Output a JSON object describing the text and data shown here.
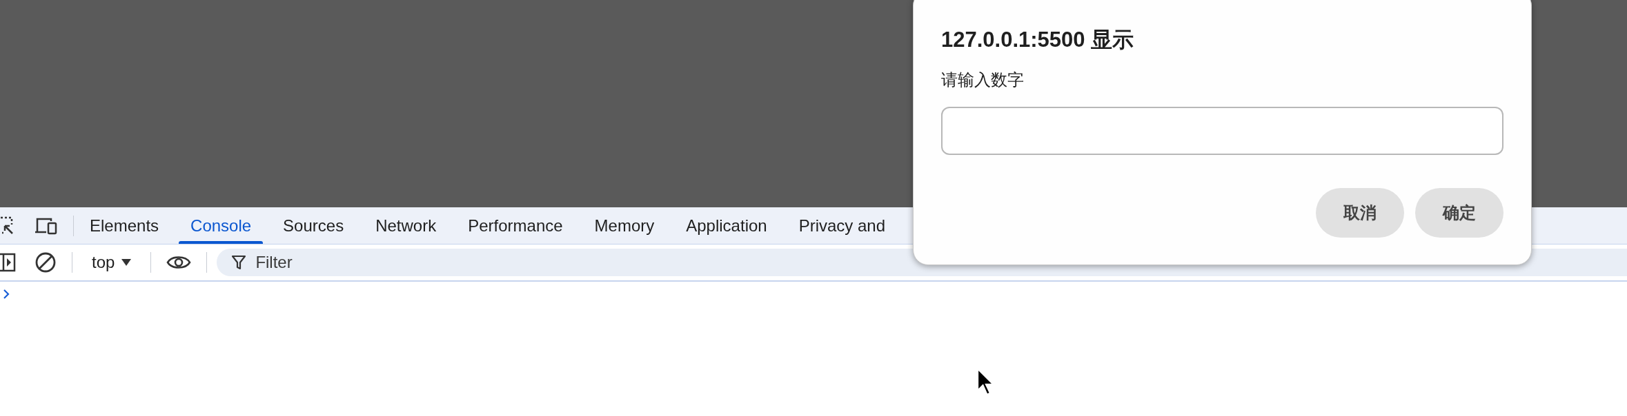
{
  "devtools": {
    "tabs": [
      {
        "label": "Elements",
        "selected": false
      },
      {
        "label": "Console",
        "selected": true
      },
      {
        "label": "Sources",
        "selected": false
      },
      {
        "label": "Network",
        "selected": false
      },
      {
        "label": "Performance",
        "selected": false
      },
      {
        "label": "Memory",
        "selected": false
      },
      {
        "label": "Application",
        "selected": false
      },
      {
        "label": "Privacy and",
        "selected": false
      }
    ],
    "console_toolbar": {
      "context": "top",
      "filter_placeholder": "Filter"
    }
  },
  "dialog": {
    "title": "127.0.0.1:5500 显示",
    "message": "请输入数字",
    "buttons": [
      "取消",
      "确定"
    ]
  }
}
